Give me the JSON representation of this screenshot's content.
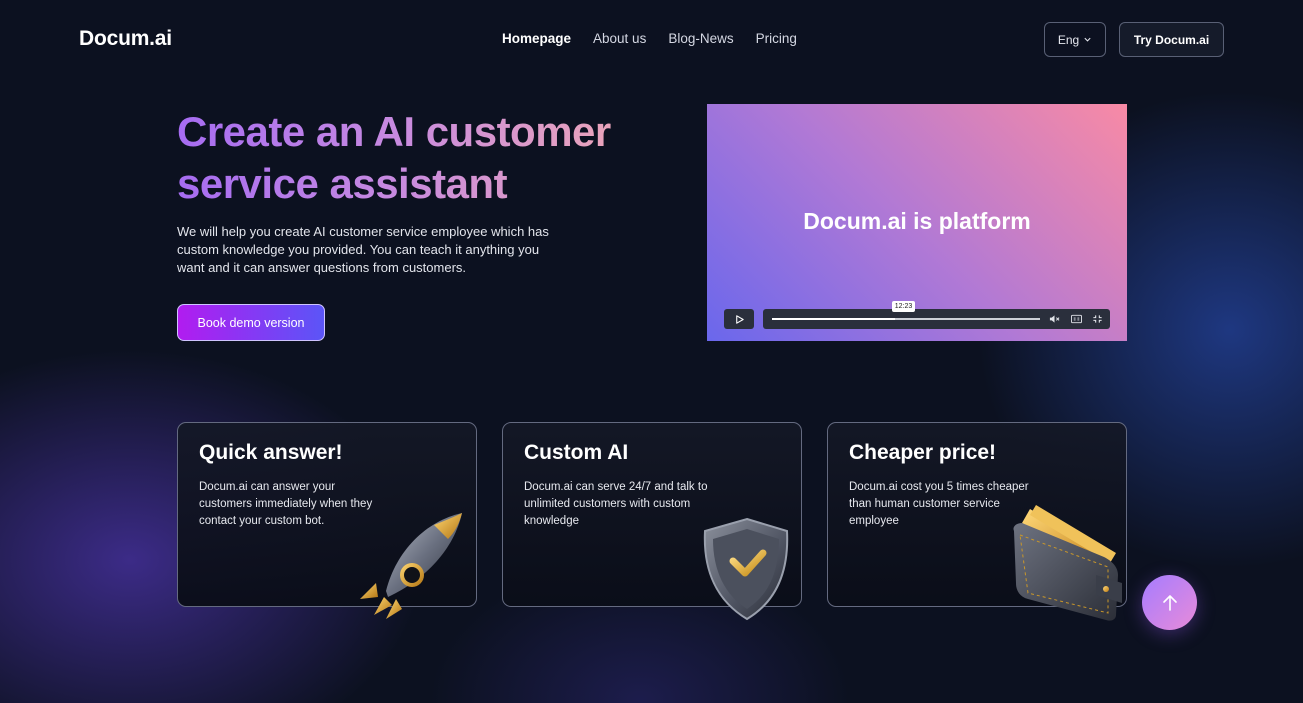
{
  "brand": {
    "logo": "Docum.ai"
  },
  "nav": {
    "items": [
      {
        "label": "Homepage",
        "active": true
      },
      {
        "label": "About us",
        "active": false
      },
      {
        "label": "Blog-News",
        "active": false
      },
      {
        "label": "Pricing",
        "active": false
      }
    ]
  },
  "header": {
    "language": "Eng",
    "cta": "Try Docum.ai"
  },
  "hero": {
    "title": "Create an AI customer service assistant",
    "description": "We will help you create AI customer service employee which has custom knowledge you provided. You can teach it anything you want and it can answer questions from customers.",
    "button": "Book demo version"
  },
  "video": {
    "title": "Docum.ai is platform",
    "timestamp": "12:23",
    "progress": 0.46,
    "icons": [
      "play-icon",
      "volume-icon",
      "captions-icon",
      "fullscreen-icon"
    ]
  },
  "features": [
    {
      "title": "Quick answer!",
      "text": "Docum.ai can answer your customers immediately  when they contact your custom bot.",
      "icon": "rocket-icon"
    },
    {
      "title": "Custom AI",
      "text": "Docum.ai can serve 24/7 and talk to unlimited customers with custom knowledge",
      "icon": "shield-check-icon"
    },
    {
      "title": "Cheaper price!",
      "text": "Docum.ai cost you 5 times cheaper than human customer service employee",
      "icon": "wallet-icon"
    }
  ],
  "scroll_top": {
    "icon": "arrow-up-icon"
  },
  "colors": {
    "background": "#0c1120",
    "accent_start": "#b11cf0",
    "accent_end": "#5b55f7",
    "title_gradient_start": "#a66cf2",
    "title_gradient_end": "#f1a9b3"
  }
}
